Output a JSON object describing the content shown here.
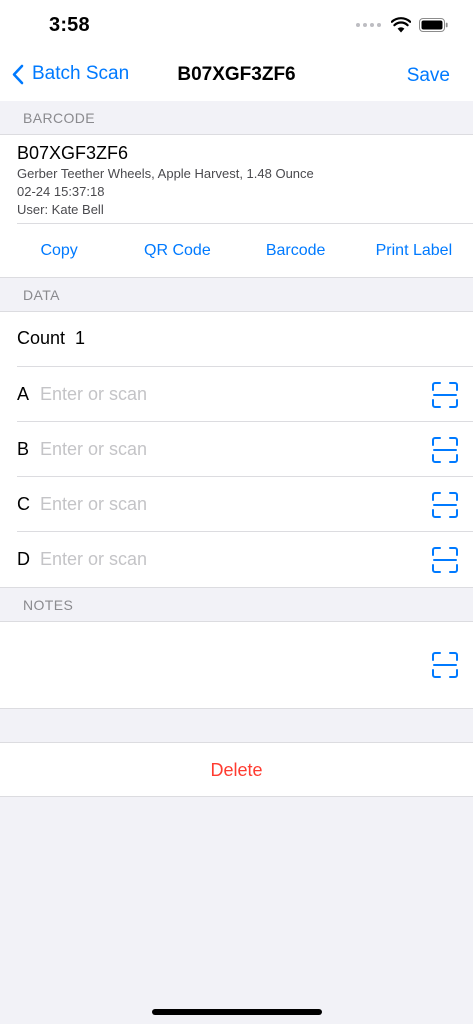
{
  "status_bar": {
    "time": "3:58"
  },
  "nav": {
    "back_label": "Batch Scan",
    "title": "B07XGF3ZF6",
    "save_label": "Save"
  },
  "barcode_section": {
    "header": "BARCODE",
    "code": "B07XGF3ZF6",
    "description": "Gerber Teether Wheels, Apple Harvest, 1.48 Ounce",
    "timestamp": "02-24 15:37:18",
    "user": "User: Kate Bell",
    "actions": [
      "Copy",
      "QR Code",
      "Barcode",
      "Print Label"
    ]
  },
  "data_section": {
    "header": "DATA",
    "count_label": "Count  1",
    "fields": [
      {
        "letter": "A",
        "value": "",
        "placeholder": "Enter or scan"
      },
      {
        "letter": "B",
        "value": "",
        "placeholder": "Enter or scan"
      },
      {
        "letter": "C",
        "value": "",
        "placeholder": "Enter or scan"
      },
      {
        "letter": "D",
        "value": "",
        "placeholder": "Enter or scan"
      }
    ]
  },
  "notes_section": {
    "header": "NOTES",
    "value": ""
  },
  "delete_label": "Delete",
  "colors": {
    "accent": "#007AFF",
    "destructive": "#FF3B30",
    "background": "#F2F2F7"
  },
  "icons": {
    "back": "chevron-left-icon",
    "scan": "scan-frame-icon",
    "wifi": "wifi-icon",
    "battery": "battery-icon"
  }
}
